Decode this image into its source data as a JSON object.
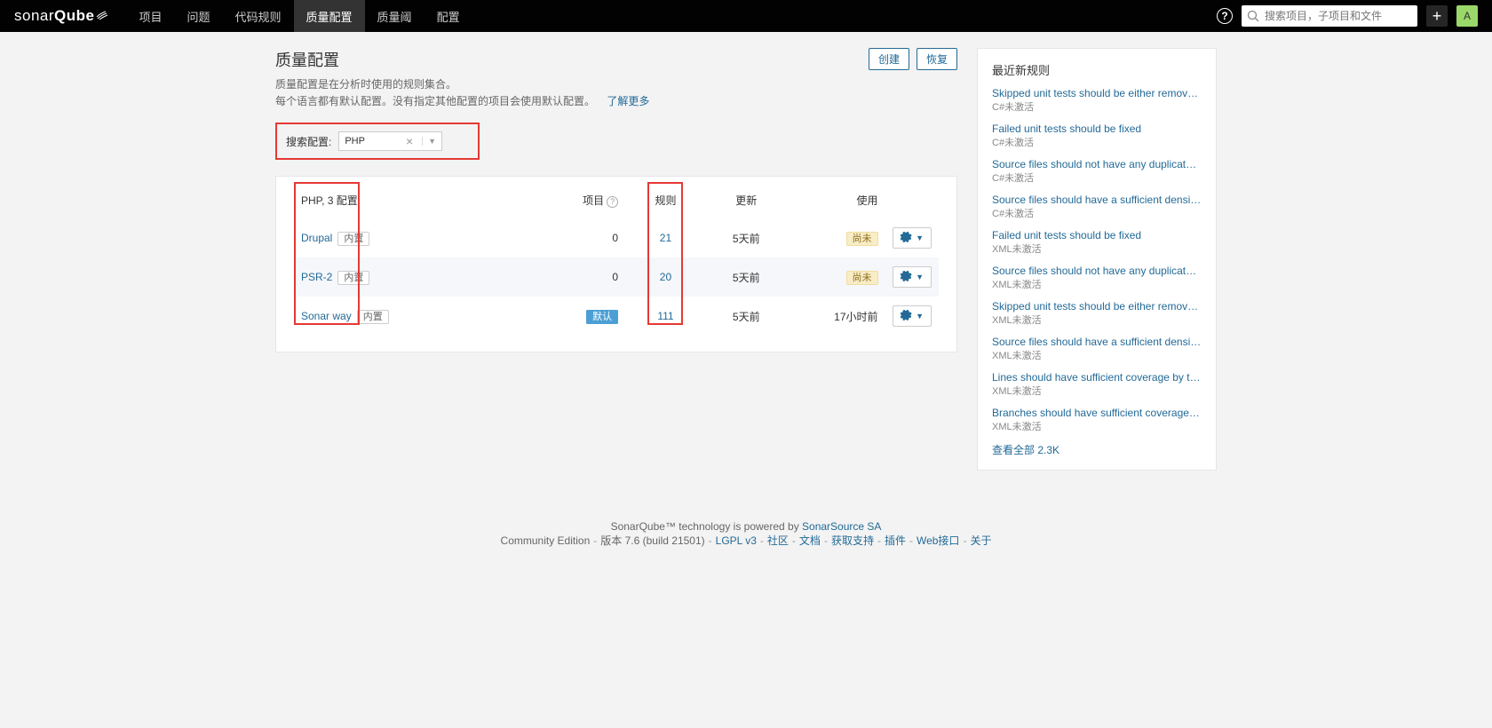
{
  "brand": {
    "name1": "sonar",
    "name2": "Qube"
  },
  "nav": {
    "items": [
      "项目",
      "问题",
      "代码规则",
      "质量配置",
      "质量阈",
      "配置"
    ],
    "activeIndex": 3
  },
  "search": {
    "placeholder": "搜索项目，子项目和文件"
  },
  "avatar": {
    "letter": "A"
  },
  "header": {
    "title": "质量配置",
    "create": "创建",
    "restore": "恢复"
  },
  "desc": {
    "line1": "质量配置是在分析时使用的规则集合。",
    "line2": "每个语言都有默认配置。没有指定其他配置的项目会使用默认配置。",
    "learn": "了解更多"
  },
  "filter": {
    "label": "搜索配置:",
    "value": "PHP"
  },
  "cols": {
    "lang": "PHP, 3 配置",
    "projects": "项目",
    "rules": "规则",
    "updated": "更新",
    "used": "使用"
  },
  "tags": {
    "builtin": "内置",
    "default": "默认",
    "never": "尚未"
  },
  "rows": [
    {
      "name": "Drupal",
      "builtin": true,
      "projects": "0",
      "rules": "21",
      "updated": "5天前",
      "used_never": true,
      "used": ""
    },
    {
      "name": "PSR-2",
      "builtin": true,
      "projects": "0",
      "rules": "20",
      "updated": "5天前",
      "used_never": true,
      "used": "",
      "hl": true
    },
    {
      "name": "Sonar way",
      "builtin": true,
      "projects": "",
      "rules": "111",
      "updated": "5天前",
      "used_never": false,
      "used": "17小时前",
      "default": true
    }
  ],
  "sidebar": {
    "title": "最近新规则",
    "items": [
      {
        "t": "Skipped unit tests should be either removed or fixed",
        "m": "C#未激活"
      },
      {
        "t": "Failed unit tests should be fixed",
        "m": "C#未激活"
      },
      {
        "t": "Source files should not have any duplicated blocks",
        "m": "C#未激活"
      },
      {
        "t": "Source files should have a sufficient density of com...",
        "m": "C#未激活"
      },
      {
        "t": "Failed unit tests should be fixed",
        "m": "XML未激活"
      },
      {
        "t": "Source files should not have any duplicated blocks",
        "m": "XML未激活"
      },
      {
        "t": "Skipped unit tests should be either removed or fixed",
        "m": "XML未激活"
      },
      {
        "t": "Source files should have a sufficient density of com...",
        "m": "XML未激活"
      },
      {
        "t": "Lines should have sufficient coverage by tests",
        "m": "XML未激活"
      },
      {
        "t": "Branches should have sufficient coverage by tests",
        "m": "XML未激活"
      }
    ],
    "seeAll": "查看全部 2.3K"
  },
  "footer": {
    "powered": "SonarQube™ technology is powered by ",
    "src": "SonarSource SA",
    "edition": "Community Edition",
    "version": "版本 7.6 (build 21501)",
    "lgpl": "LGPL v3",
    "links": [
      "社区",
      "文档",
      "获取支持",
      "插件",
      "Web接口",
      "关于"
    ]
  }
}
